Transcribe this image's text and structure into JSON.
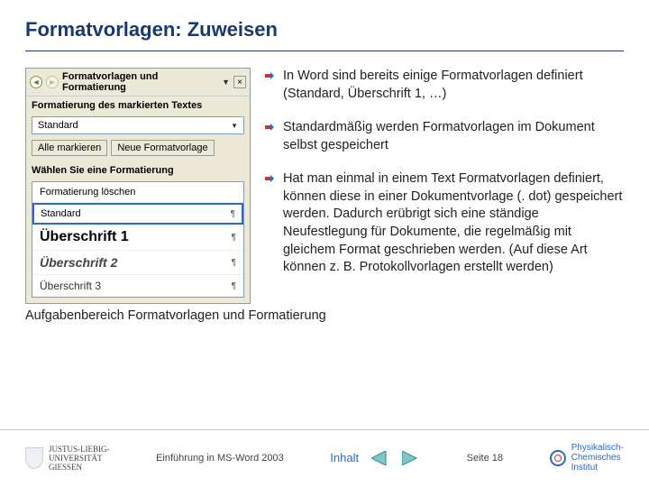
{
  "title": "Formatvorlagen: Zuweisen",
  "panel": {
    "heading": "Formatvorlagen und Formatierung",
    "section1": "Formatierung des markierten Textes",
    "currentStyle": "Standard",
    "btnSelectAll": "Alle markieren",
    "btnNew": "Neue Formatvorlage",
    "section2": "Wählen Sie eine Formatierung",
    "items": {
      "clear": "Formatierung löschen",
      "standard": "Standard",
      "h1": "Überschrift 1",
      "h2": "Überschrift 2",
      "h3": "Überschrift 3"
    },
    "paraMark": "¶"
  },
  "bullets": {
    "b1": "In Word sind bereits einige Formatvorlagen definiert (Standard, Überschrift 1, …)",
    "b2": "Standardmäßig werden Formatvorlagen im Dokument selbst gespeichert",
    "b3": "Hat man einmal in einem Text Formatvorlagen definiert, können diese in einer Dokumentvorlage (. dot) gespeichert werden. Dadurch erübrigt sich eine ständige Neufestlegung für Dokumente, die regelmäßig mit gleichem Format geschrieben werden. (Auf diese Art können z. B. Protokoll­vorlagen erstellt werden)"
  },
  "caption": "Aufgabenbereich Formatvorlagen und Formatierung",
  "footer": {
    "uniLine1": "JUSTUS-LIEBIG-",
    "uniLine2": "UNIVERSITÄT",
    "uniLine3": "GIESSEN",
    "course": "Einführung in MS-Word 2003",
    "inhalt": "Inhalt",
    "page": "Seite 18",
    "instLine1": "Physikalisch-",
    "instLine2": "Chemisches",
    "instLine3": "Institut"
  }
}
